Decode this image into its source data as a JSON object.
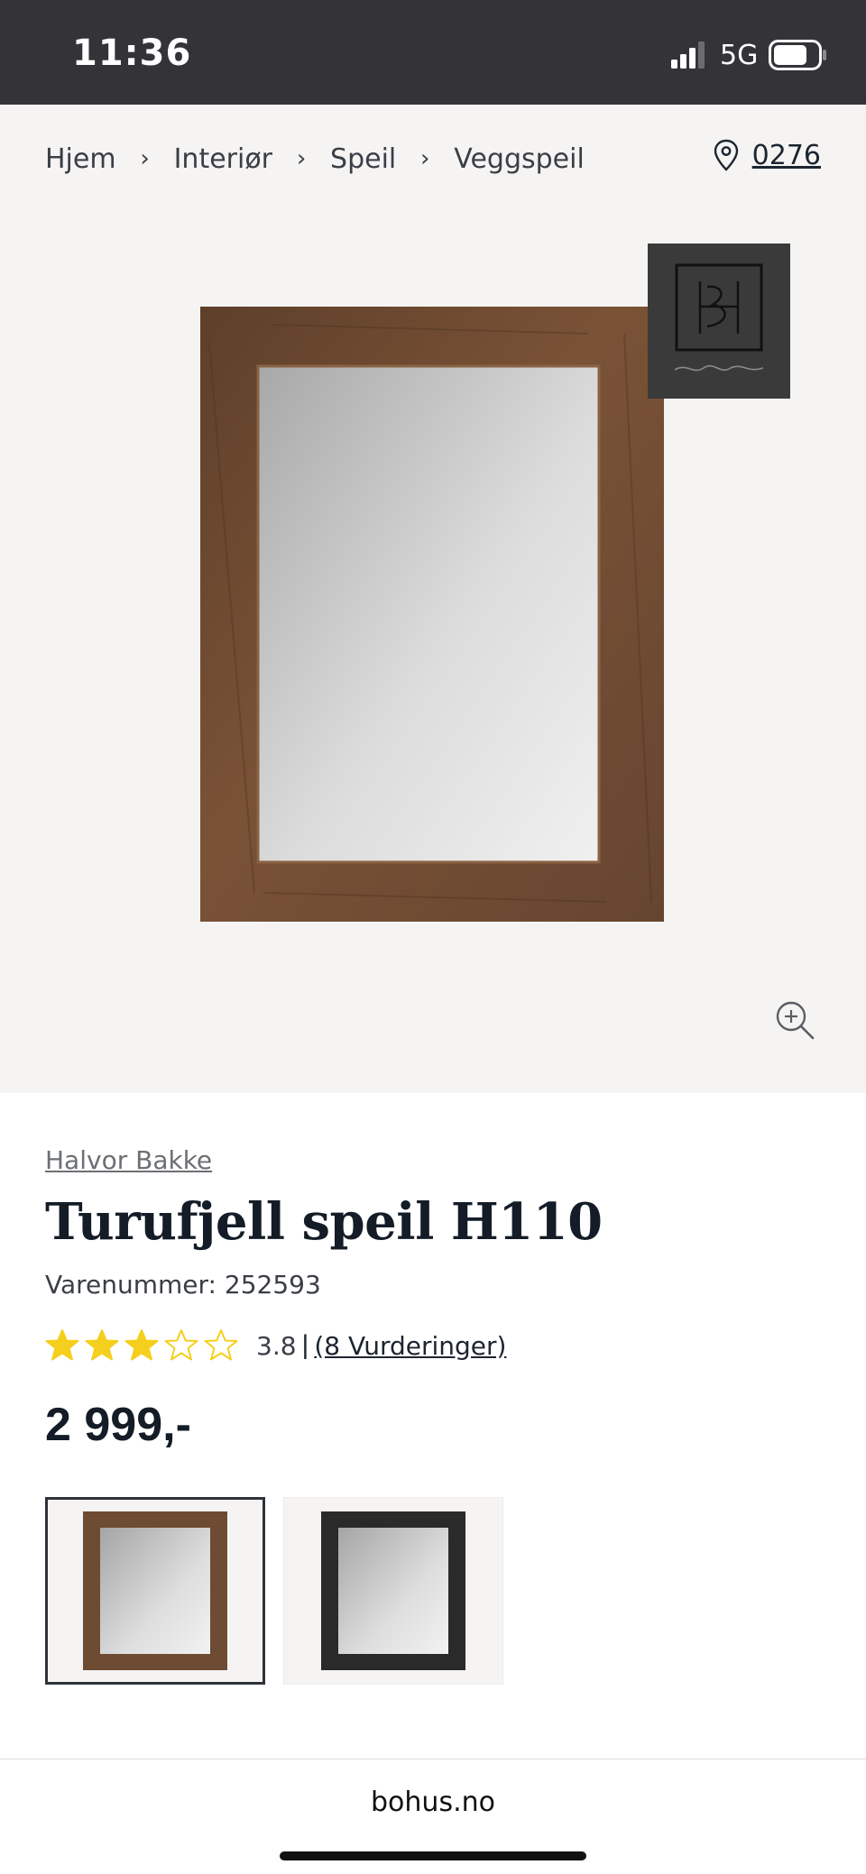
{
  "status_bar": {
    "time": "11:36",
    "network": "5G",
    "icons": [
      "signal-icon",
      "battery-icon"
    ]
  },
  "breadcrumb": {
    "items": [
      "Hjem",
      "Interiør",
      "Speil",
      "Veggspeil"
    ],
    "separator_icon": "chevron-right-icon"
  },
  "store": {
    "icon": "location-pin-icon",
    "number": "0276"
  },
  "product": {
    "brand": "Halvor Bakke",
    "title": "Turufjell speil H110",
    "sku": "Varenummer: 252593",
    "rating": {
      "value": "3.8",
      "stars_value": 3.8,
      "stars_max": 5,
      "separator": "|",
      "count_label": "(8 Vurderinger)",
      "star_color": "#f5cf1d"
    },
    "price": "2 999,-",
    "variants": [
      {
        "name": "brown-wood",
        "selected": true,
        "frame_color": "#6e4b33"
      },
      {
        "name": "black",
        "selected": false,
        "frame_color": "#2a2a2a"
      }
    ]
  },
  "brand_badge": {
    "monogram": "HB",
    "signature": "Halvor Bakke"
  },
  "icons": {
    "zoom": "zoom-in-icon"
  },
  "browser": {
    "url": "bohus.no"
  },
  "colors": {
    "status_bar_bg": "#333338",
    "hero_bg": "#f5f4f3",
    "text_dark": "#141c27",
    "muted": "#6c6f73"
  }
}
